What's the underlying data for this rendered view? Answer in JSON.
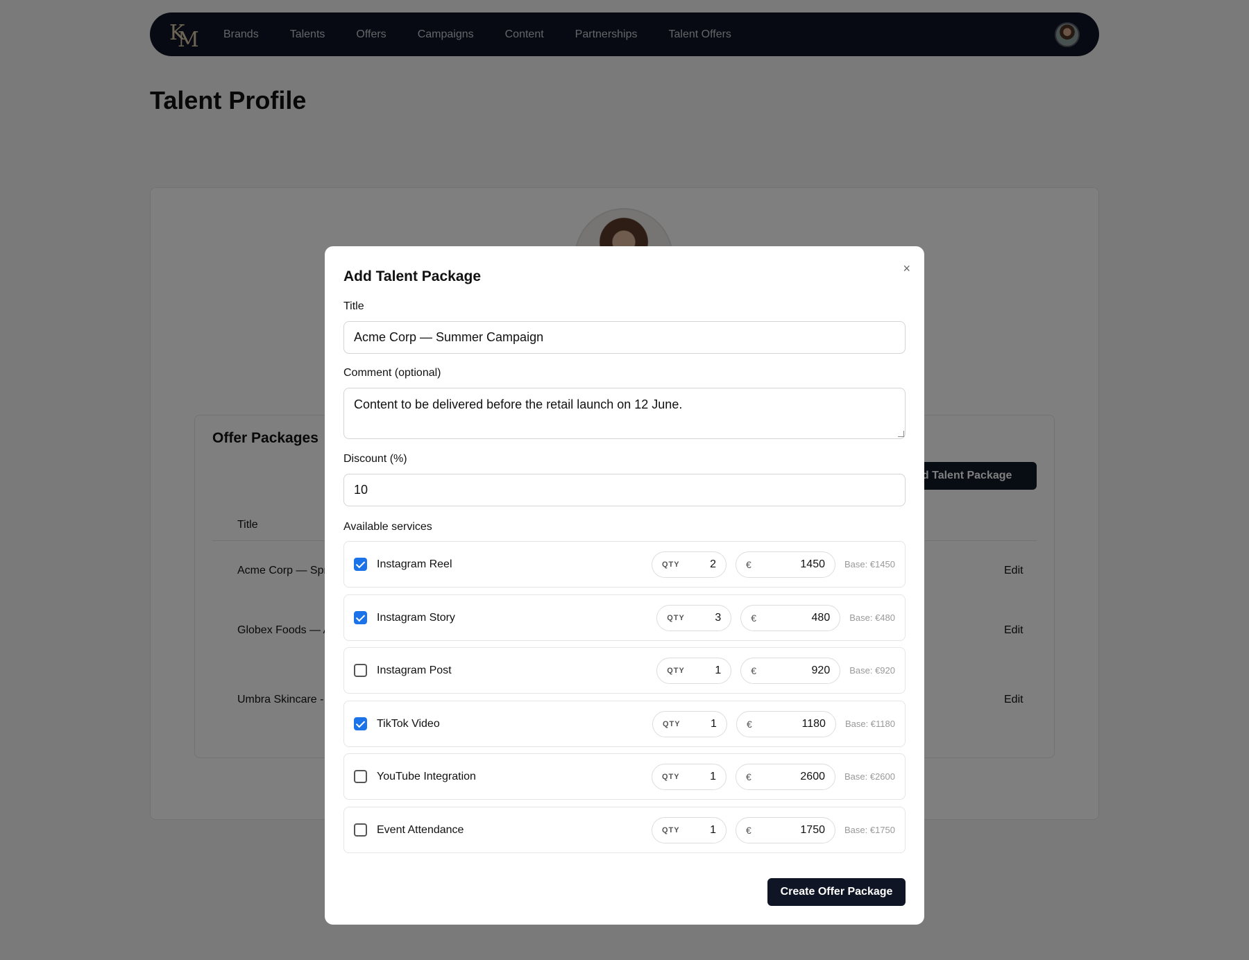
{
  "nav": {
    "logo": {
      "k": "K",
      "m": "M"
    },
    "links": [
      "Brands",
      "Talents",
      "Offers",
      "Campaigns",
      "Content",
      "Partnerships",
      "Talent Offers"
    ]
  },
  "page": {
    "title": "Talent Profile"
  },
  "background": {
    "offer_packages_title": "Offer Packages",
    "add_button": "Add Talent Package",
    "table_header_title": "Title",
    "rows": [
      {
        "title": "Acme Corp — Spr",
        "edit": "Edit"
      },
      {
        "title": "Globex Foods — A",
        "edit": "Edit"
      },
      {
        "title": "Umbra Skincare - ",
        "edit": "Edit"
      }
    ]
  },
  "modal": {
    "title": "Add Talent Package",
    "close": "×",
    "title_label": "Title",
    "title_value": "Acme Corp — Summer Campaign",
    "comment_label": "Comment (optional)",
    "comment_value": "Content to be delivered before the retail launch on 12 June.",
    "discount_label": "Discount (%)",
    "discount_value": "10",
    "services_label": "Available services",
    "qty_label": "QTY",
    "currency": "€",
    "services": [
      {
        "name": "Instagram Reel",
        "checked": true,
        "qty": "2",
        "price": "1450",
        "base": "Base: €1450"
      },
      {
        "name": "Instagram Story",
        "checked": true,
        "qty": "3",
        "price": "480",
        "base": "Base: €480"
      },
      {
        "name": "Instagram Post",
        "checked": false,
        "qty": "1",
        "price": "920",
        "base": "Base: €920"
      },
      {
        "name": "TikTok Video",
        "checked": true,
        "qty": "1",
        "price": "1180",
        "base": "Base: €1180"
      },
      {
        "name": "YouTube Integration",
        "checked": false,
        "qty": "1",
        "price": "2600",
        "base": "Base: €2600"
      },
      {
        "name": "Event Attendance",
        "checked": false,
        "qty": "1",
        "price": "1750",
        "base": "Base: €1750"
      }
    ],
    "create_button": "Create Offer Package"
  }
}
